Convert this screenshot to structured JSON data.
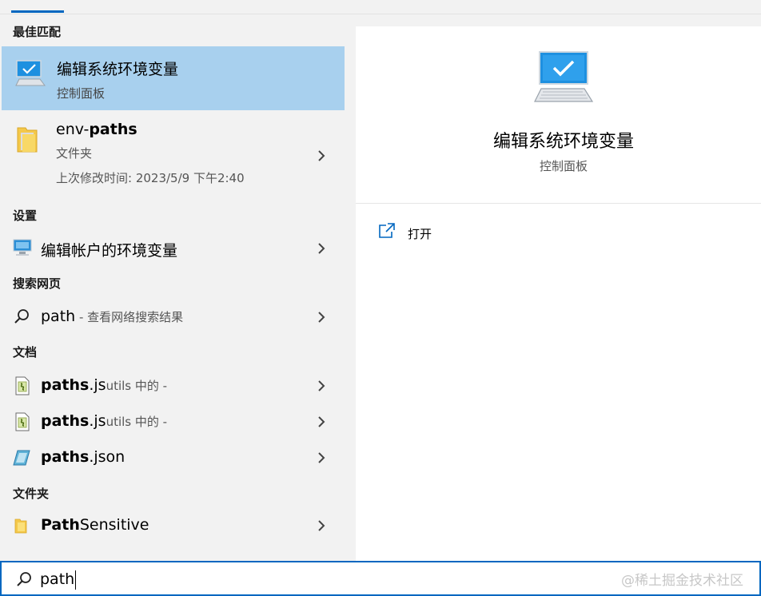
{
  "sections": {
    "best_match": "最佳匹配",
    "settings": "设置",
    "web": "搜索网页",
    "documents": "文档",
    "folders": "文件夹"
  },
  "best_match": {
    "title": "编辑系统环境变量",
    "subtitle": "控制面板",
    "icon": "monitor-check-icon"
  },
  "env_paths": {
    "title_plain": "env-",
    "title_bold": "paths",
    "type": "文件夹",
    "date": "上次修改时间: 2023/5/9 下午2:40",
    "icon": "folder-icon"
  },
  "settings_item": {
    "label": "编辑帐户的环境变量",
    "icon": "monitor-settings-icon"
  },
  "web_item": {
    "query": "path",
    "suffix": " - 查看网络搜索结果",
    "icon": "search-icon"
  },
  "documents": [
    {
      "bold": "paths",
      "plain": ".js",
      "muted": "utils 中的 -",
      "icon": "js-file-icon"
    },
    {
      "bold": "paths",
      "plain": ".js",
      "muted": "utils 中的 -",
      "icon": "js-file-icon"
    },
    {
      "bold": "paths",
      "plain": ".json",
      "muted": "",
      "icon": "json-file-icon"
    }
  ],
  "folders": [
    {
      "bold": "Path",
      "plain": "Sensitive",
      "icon": "folder-icon"
    }
  ],
  "preview": {
    "title": "编辑系统环境变量",
    "subtitle": "控制面板",
    "open_label": "打开",
    "icon": "monitor-check-icon"
  },
  "search": {
    "value": "path",
    "watermark": "@稀土掘金技术社区"
  },
  "colors": {
    "accent": "#0067c0",
    "selection": "#a8d0ee",
    "pane_bg": "#f2f2f2",
    "preview_bg": "#ffffff"
  }
}
